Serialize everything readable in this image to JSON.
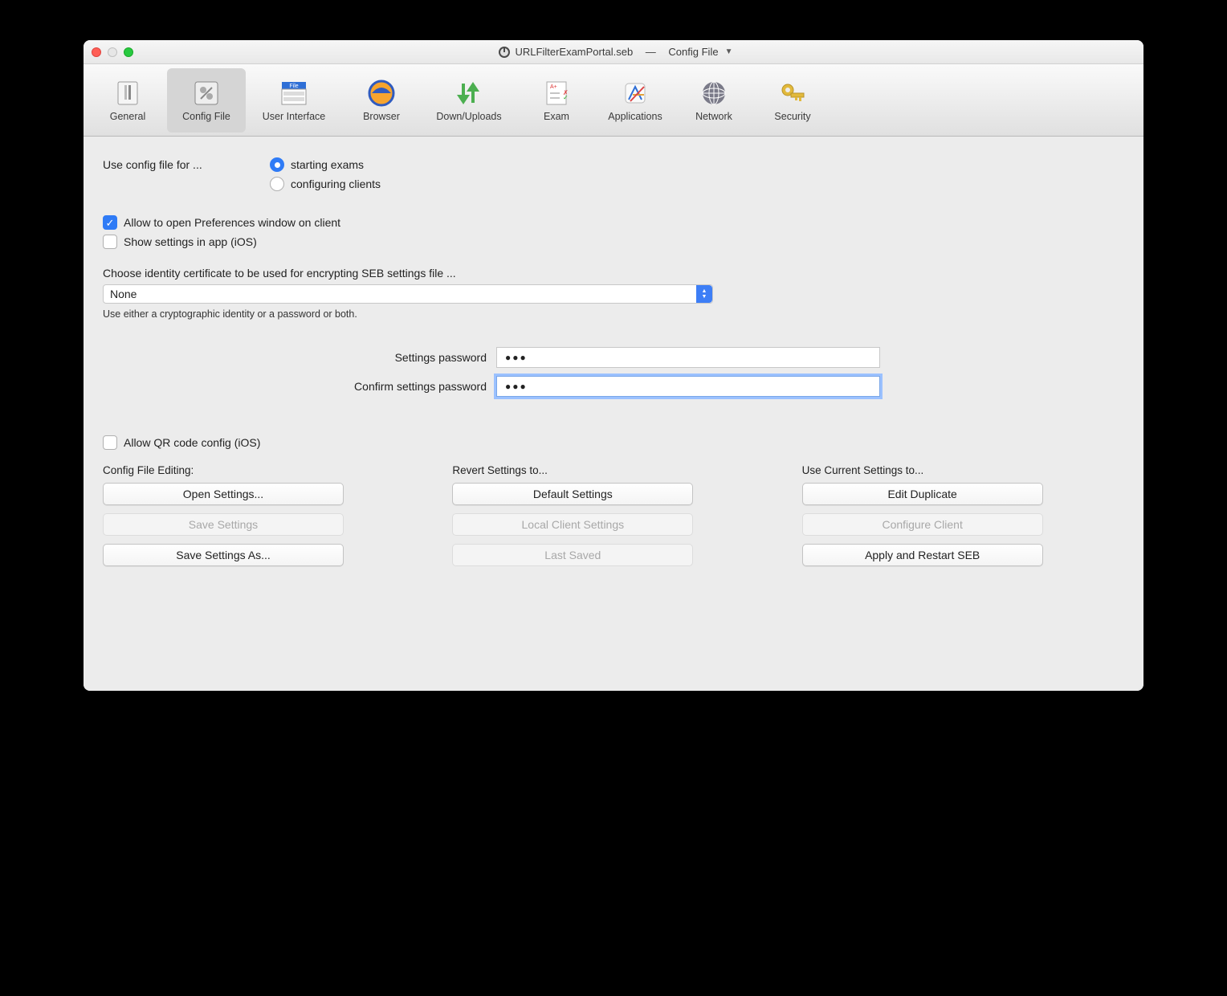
{
  "window": {
    "title_file": "URLFilterExamPortal.seb",
    "title_separator": "—",
    "title_section": "Config File"
  },
  "toolbar": {
    "items": [
      {
        "label": "General"
      },
      {
        "label": "Config File"
      },
      {
        "label": "User Interface"
      },
      {
        "label": "Browser"
      },
      {
        "label": "Down/Uploads"
      },
      {
        "label": "Exam"
      },
      {
        "label": "Applications"
      },
      {
        "label": "Network"
      },
      {
        "label": "Security"
      }
    ],
    "selected_index": 1
  },
  "config": {
    "use_config_label": "Use config file for ...",
    "radio_starting": "starting exams",
    "radio_configuring": "configuring clients",
    "allow_prefs": "Allow to open Preferences window on client",
    "show_settings_ios": "Show settings in app (iOS)",
    "cert_label": "Choose identity certificate to be used for encrypting SEB settings file ...",
    "cert_value": "None",
    "cert_hint": "Use either a cryptographic identity or a password or both.",
    "pw_label": "Settings password",
    "pw_confirm_label": "Confirm settings password",
    "pw_placeholder": "●●●",
    "pw_confirm_placeholder": "●●●",
    "allow_qr": "Allow QR code config (iOS)"
  },
  "columns": {
    "editing_label": "Config File Editing:",
    "revert_label": "Revert Settings to...",
    "use_current_label": "Use Current Settings to...",
    "open_settings": "Open Settings...",
    "save_settings": "Save Settings",
    "save_settings_as": "Save Settings As...",
    "default_settings": "Default Settings",
    "local_client_settings": "Local Client Settings",
    "last_saved": "Last Saved",
    "edit_duplicate": "Edit Duplicate",
    "configure_client": "Configure Client",
    "apply_restart": "Apply and Restart SEB"
  }
}
